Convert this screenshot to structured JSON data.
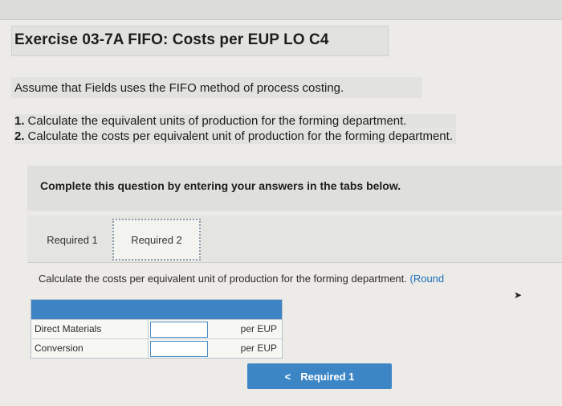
{
  "header": {
    "title": "Exercise 03-7A FIFO: Costs per EUP LO C4"
  },
  "intro": {
    "assume": "Assume that Fields uses the FIFO method of process costing.",
    "steps": [
      {
        "num": "1.",
        "text": "Calculate the equivalent units of production for the forming department."
      },
      {
        "num": "2.",
        "text": "Calculate the costs per equivalent unit of production for the forming department."
      }
    ]
  },
  "instruction": "Complete this question by entering your answers in the tabs below.",
  "tabs": [
    {
      "label": "Required 1",
      "active": false
    },
    {
      "label": "Required 2",
      "active": true
    }
  ],
  "prompt": {
    "text": "Calculate the costs per equivalent unit of production for the forming department.",
    "round": "(Round"
  },
  "table": {
    "rows": [
      {
        "label": "Direct Materials",
        "value": "",
        "unit": "per EUP"
      },
      {
        "label": "Conversion",
        "value": "",
        "unit": "per EUP"
      }
    ]
  },
  "nav": {
    "back_label": "Required 1",
    "back_icon": "chevron-left-icon"
  },
  "colors": {
    "accent": "#3d86c6",
    "background": "#ecebe8"
  }
}
